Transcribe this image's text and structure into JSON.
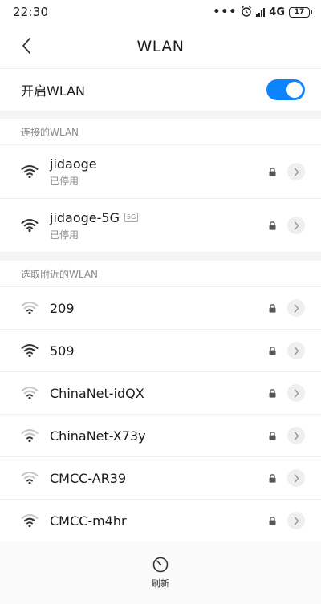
{
  "status_bar": {
    "time": "22:30",
    "dots": "•••",
    "network": "4G",
    "battery": "17"
  },
  "header": {
    "title": "WLAN"
  },
  "toggle": {
    "label": "开启WLAN",
    "enabled": true
  },
  "connected_section": {
    "title": "连接的WLAN",
    "networks": [
      {
        "ssid": "jidaoge",
        "status": "已停用",
        "band": "",
        "signal": 4,
        "locked": true
      },
      {
        "ssid": "jidaoge-5G",
        "status": "已停用",
        "band": "5G",
        "signal": 4,
        "locked": true
      }
    ]
  },
  "nearby_section": {
    "title": "选取附近的WLAN",
    "networks": [
      {
        "ssid": "209",
        "signal": 2,
        "locked": true
      },
      {
        "ssid": "509",
        "signal": 4,
        "locked": true
      },
      {
        "ssid": "ChinaNet-idQX",
        "signal": 2,
        "locked": true
      },
      {
        "ssid": "ChinaNet-X73y",
        "signal": 2,
        "locked": true
      },
      {
        "ssid": "CMCC-AR39",
        "signal": 2,
        "locked": true
      },
      {
        "ssid": "CMCC-m4hr",
        "signal": 3,
        "locked": true
      }
    ]
  },
  "bottom": {
    "refresh_label": "刷新"
  },
  "colors": {
    "accent": "#0d84ff",
    "icon_strong": "#333333",
    "icon_weak": "#c6c6c6"
  }
}
